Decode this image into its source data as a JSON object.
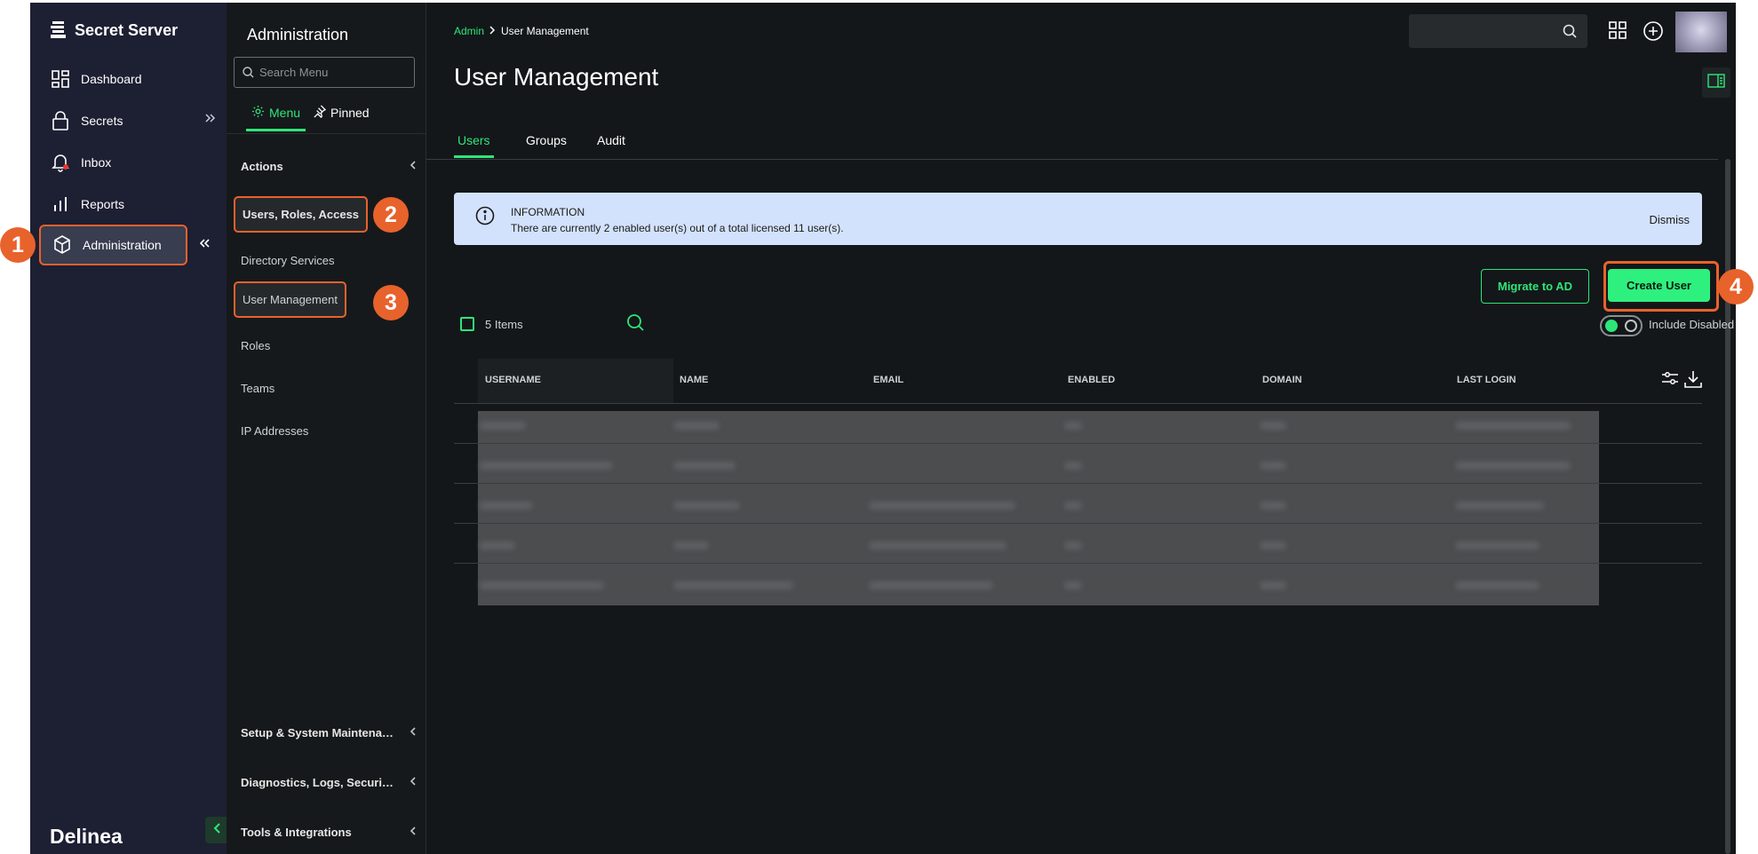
{
  "brand": {
    "name": "Secret Server",
    "logo_text": "Delinea"
  },
  "nav": {
    "items": [
      {
        "label": "Dashboard"
      },
      {
        "label": "Secrets"
      },
      {
        "label": "Inbox"
      },
      {
        "label": "Reports"
      },
      {
        "label": "Administration"
      }
    ]
  },
  "submenu": {
    "title": "Administration",
    "search_placeholder": "Search Menu",
    "tabs": {
      "menu": "Menu",
      "pinned": "Pinned"
    },
    "sections": {
      "actions": "Actions",
      "setup": "Setup & System Maintena…",
      "diagnostics": "Diagnostics, Logs, Securi…",
      "tools": "Tools & Integrations"
    },
    "items": [
      {
        "label": "Users, Roles, Access"
      },
      {
        "label": "Directory Services"
      },
      {
        "label": "User Management"
      },
      {
        "label": "Roles"
      },
      {
        "label": "Teams"
      },
      {
        "label": "IP Addresses"
      }
    ]
  },
  "breadcrumb": {
    "root": "Admin",
    "current": "User Management"
  },
  "page": {
    "title": "User Management",
    "tabs": [
      {
        "label": "Users"
      },
      {
        "label": "Groups"
      },
      {
        "label": "Audit"
      }
    ]
  },
  "info": {
    "heading": "INFORMATION",
    "text": "There are currently 2 enabled user(s) out of a total licensed 11 user(s).",
    "dismiss": "Dismiss"
  },
  "actions": {
    "migrate": "Migrate to AD",
    "create": "Create User"
  },
  "grid": {
    "count": "5 Items",
    "include_disabled": "Include Disabled",
    "include_disabled_on": true,
    "columns": [
      "USERNAME",
      "NAME",
      "EMAIL",
      "ENABLED",
      "DOMAIN",
      "LAST LOGIN"
    ]
  },
  "callouts": [
    "1",
    "2",
    "3",
    "4"
  ],
  "colors": {
    "accent": "#2ee67a",
    "callout": "#e8622c",
    "nav_bg": "#1d1f33",
    "info_bg": "#d3e2fc"
  }
}
